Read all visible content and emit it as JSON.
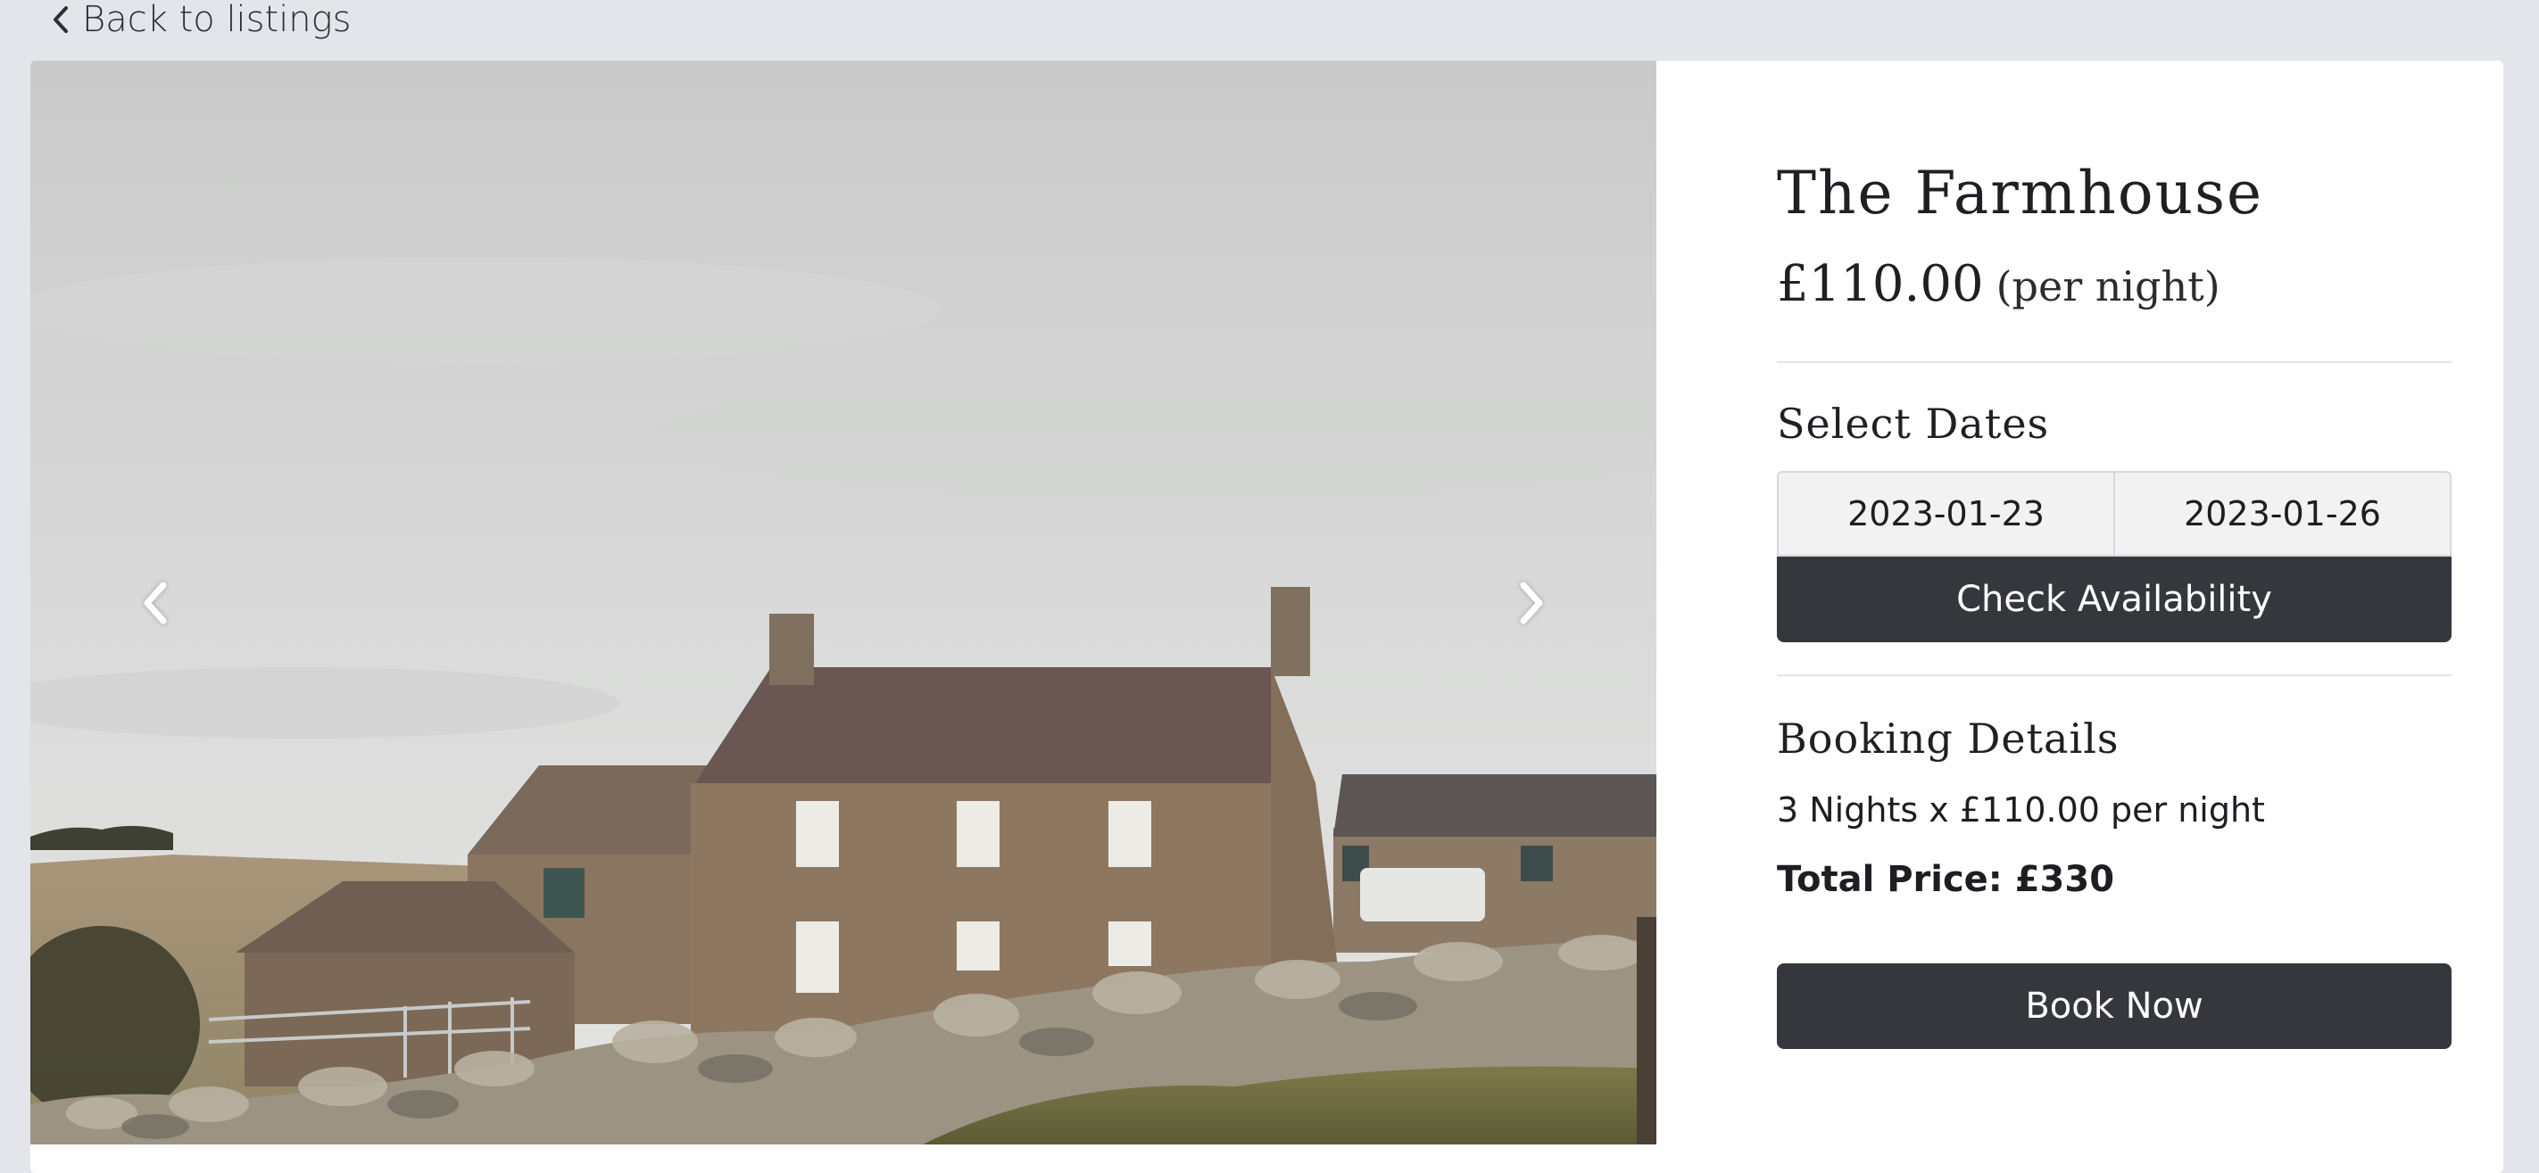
{
  "nav": {
    "back_label": "Back to listings",
    "back_icon": "chevron-left-icon"
  },
  "carousel": {
    "image_alt": "Stone farmhouse behind a dry stone wall under an overcast sky",
    "prev_icon": "chevron-left-icon",
    "next_icon": "chevron-right-icon"
  },
  "listing": {
    "title": "The Farmhouse",
    "price": "£110.00",
    "price_unit": "(per night)"
  },
  "dates": {
    "heading": "Select Dates",
    "start": "2023-01-23",
    "end": "2023-01-26",
    "check_label": "Check Availability"
  },
  "booking": {
    "heading": "Booking Details",
    "nights_line": "3 Nights x £110.00 per night",
    "total_line": "Total Price: £330",
    "book_label": "Book Now"
  },
  "colors": {
    "page_background": "#e3e5ea",
    "card_background": "#ffffff",
    "button_background": "#35373c",
    "button_text": "#ffffff",
    "date_field_background": "#f2f2f3"
  }
}
